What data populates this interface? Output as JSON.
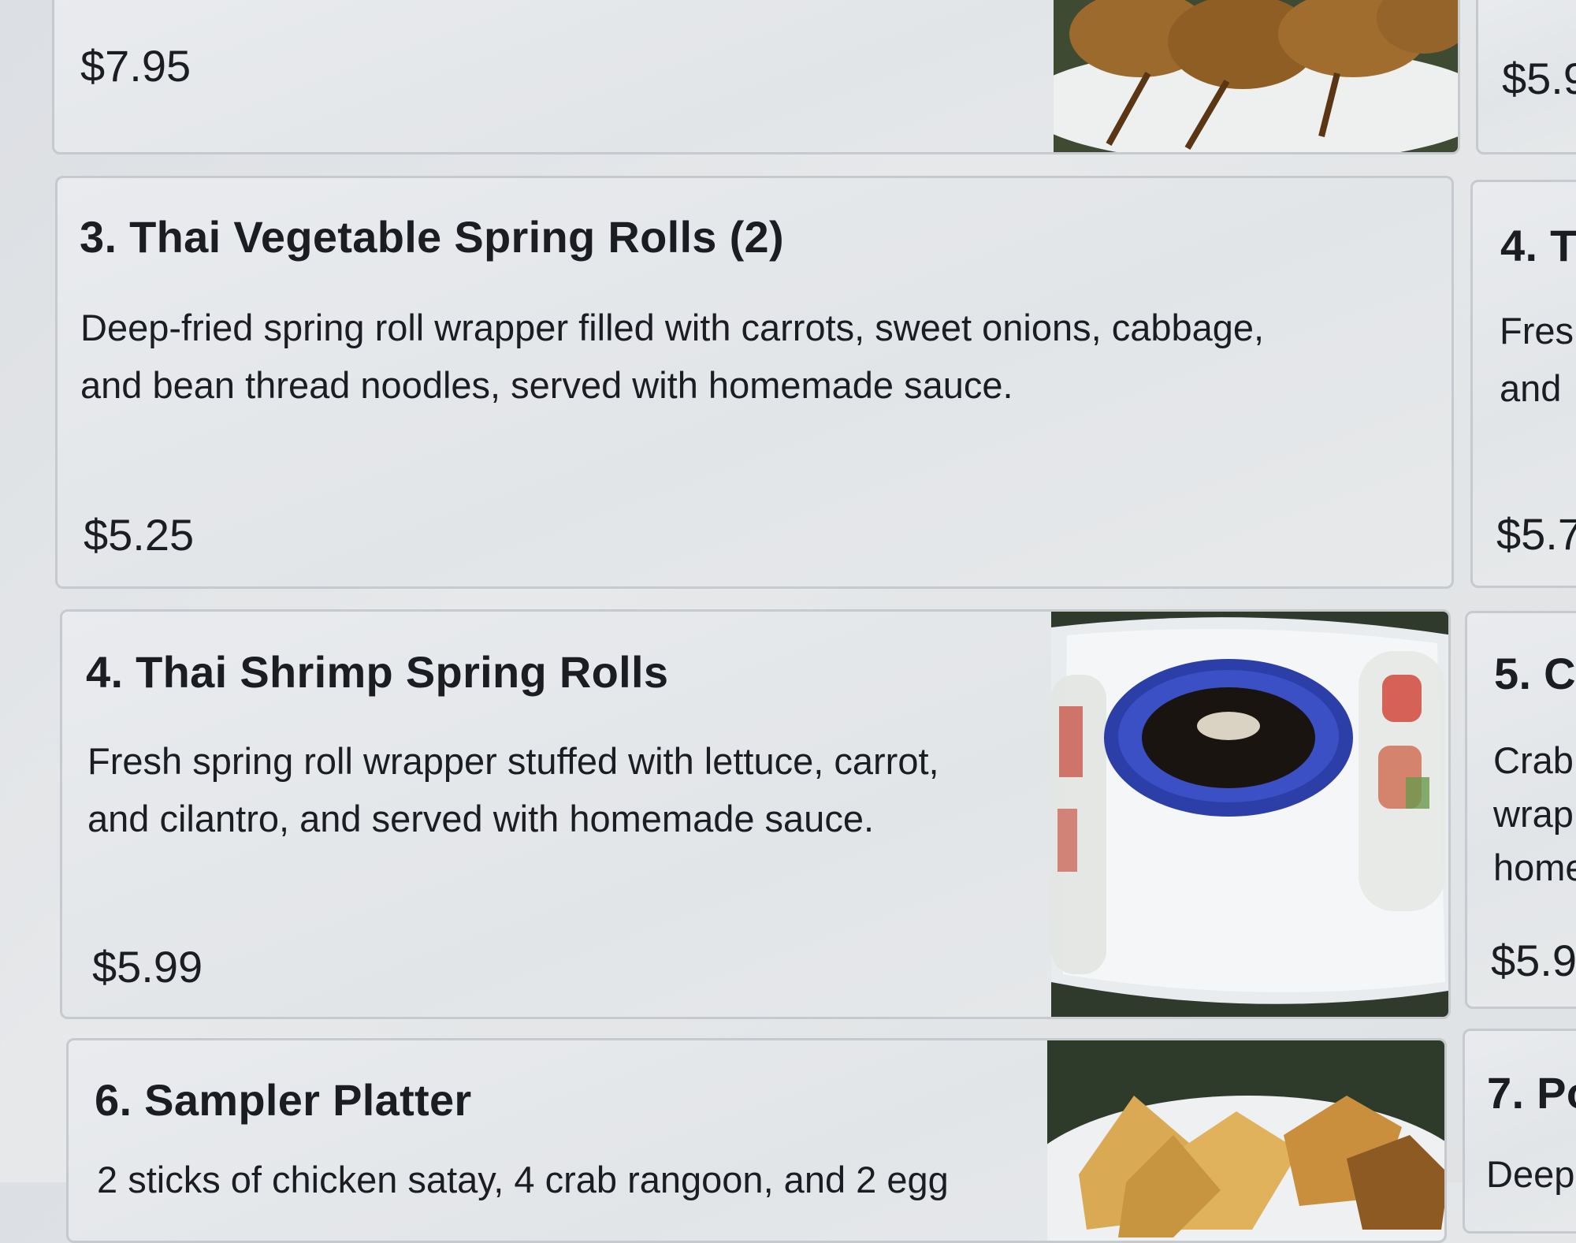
{
  "menu_items": [
    {
      "id": "item-prev",
      "price": "$7.95",
      "image_alt": "chicken satay skewers"
    },
    {
      "id": "item-prev-right",
      "price": "$5.9"
    },
    {
      "id": "item-3",
      "title": "3. Thai Vegetable Spring Rolls (2)",
      "desc_line1": "Deep-fried spring roll wrapper filled with carrots, sweet onions, cabbage,",
      "desc_line2": "and bean thread noodles, served with homemade sauce.",
      "price": "$5.25"
    },
    {
      "id": "item-4-right",
      "title": "4. T",
      "desc_line1": "Fres",
      "desc_line2": "and",
      "price": "$5.7"
    },
    {
      "id": "item-4",
      "title": "4. Thai Shrimp Spring Rolls",
      "desc_line1": "Fresh spring roll wrapper stuffed with lettuce, carrot,",
      "desc_line2": "and cilantro, and served with homemade sauce.",
      "price": "$5.99",
      "image_alt": "shrimp spring rolls with dipping sauce"
    },
    {
      "id": "item-5-right",
      "title": "5. C",
      "desc_line1": "Crab",
      "desc_line2": "wrap",
      "desc_line3": "home",
      "price": "$5.9"
    },
    {
      "id": "item-6",
      "title": "6. Sampler Platter",
      "desc_line1": "2 sticks of chicken satay, 4 crab rangoon, and 2 egg",
      "image_alt": "sampler platter"
    },
    {
      "id": "item-7-right",
      "title": "7. Po",
      "desc_line1": "Deep"
    }
  ]
}
